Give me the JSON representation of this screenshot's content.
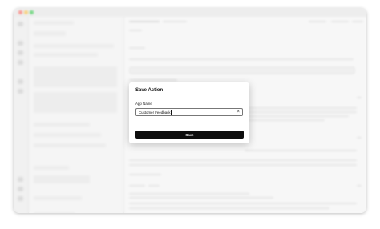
{
  "modal": {
    "title": "Save Action",
    "field_label": "App Name",
    "field_value": "Customer Feedback",
    "clear_icon": "×",
    "save_label": "Save"
  }
}
